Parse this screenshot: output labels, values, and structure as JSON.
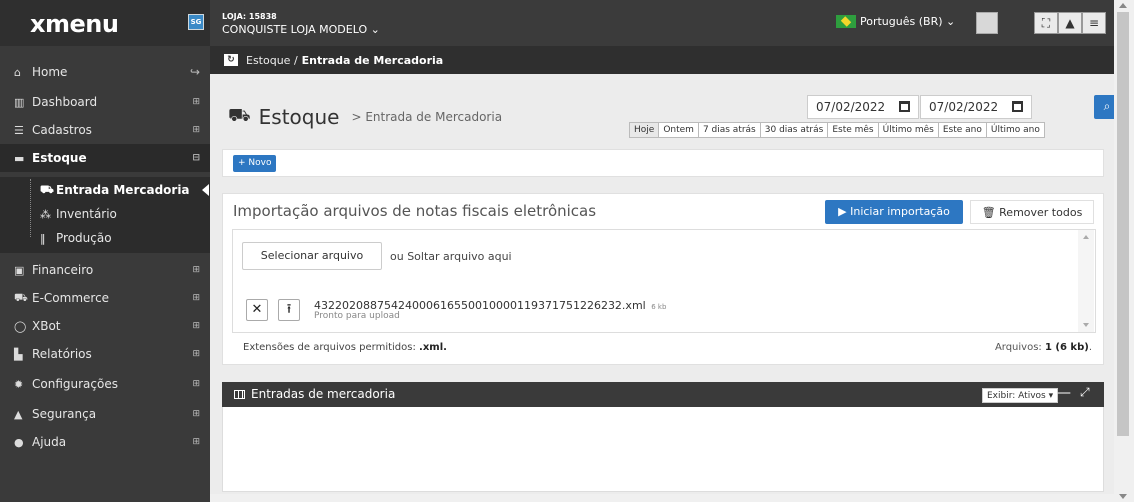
{
  "header": {
    "logo": "xmenu",
    "badge": "SG",
    "store_code": "LOJA: 15838",
    "store_name": "CONQUISTE LOJA MODELO ⌄",
    "language": "Português (BR) ⌄"
  },
  "sidebar": {
    "items": [
      {
        "label": "Home",
        "icon": "home-icon"
      },
      {
        "label": "Dashboard",
        "icon": "bar-chart-icon"
      },
      {
        "label": "Cadastros",
        "icon": "database-icon"
      },
      {
        "label": "Estoque",
        "icon": "truck-icon"
      },
      {
        "label": "Financeiro",
        "icon": "money-icon"
      },
      {
        "label": "E-Commerce",
        "icon": "cart-icon"
      },
      {
        "label": "XBot",
        "icon": "whatsapp-icon"
      },
      {
        "label": "Relatórios",
        "icon": "report-icon"
      },
      {
        "label": "Configurações",
        "icon": "gear-icon"
      },
      {
        "label": "Segurança",
        "icon": "lock-icon"
      },
      {
        "label": "Ajuda",
        "icon": "help-icon"
      }
    ],
    "sub_items": [
      {
        "label": "Entrada Mercadoria",
        "icon": "cart-icon"
      },
      {
        "label": "Inventário",
        "icon": "cubes-icon"
      },
      {
        "label": "Produção",
        "icon": "cutlery-icon"
      }
    ]
  },
  "breadcrumb": {
    "root": "Estoque /",
    "current": "Entrada de Mercadoria"
  },
  "page": {
    "title": "Estoque",
    "subtitle": "> Entrada de Mercadoria",
    "date_from": "07/02/2022",
    "date_to": "07/02/2022",
    "quick_ranges": [
      "Hoje",
      "Ontem",
      "7 dias atrás",
      "30 dias atrás",
      "Este mês",
      "Último mês",
      "Este ano",
      "Último ano"
    ],
    "new_button": "+ Novo"
  },
  "import_panel": {
    "title": "Importação arquivos de notas fiscais eletrônicas",
    "start_button": "▶ Iniciar importação",
    "remove_button": "🗑 Remover todos",
    "select_button": "Selecionar arquivo",
    "drop_text": "ou Soltar arquivo aqui",
    "file_name": "43220208875424000616550010000119371751226232.xml",
    "file_size": "6 kb",
    "file_status": "Pronto para upload",
    "ext_prefix": "Extensões de arquivos permitidos:",
    "ext_value": ".xml.",
    "count_prefix": "Arquivos:",
    "count_value": "1 (6 kb)",
    "count_suffix": "."
  },
  "entries_panel": {
    "title": "Entradas de mercadoria",
    "filter": "Exibir: Ativos ▾"
  }
}
